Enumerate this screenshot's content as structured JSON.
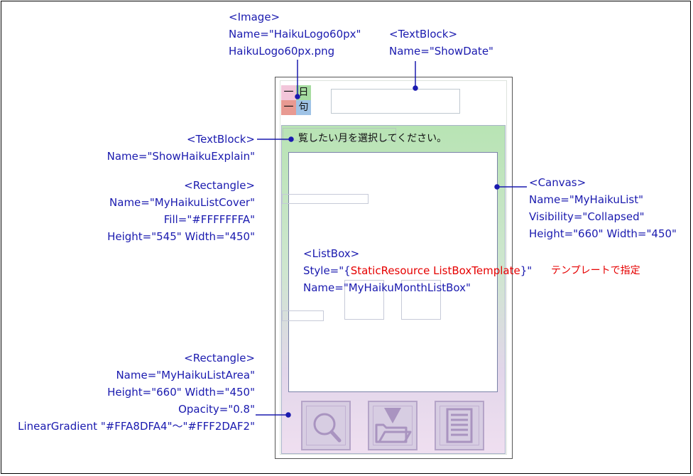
{
  "annotations": {
    "image_tag": "<Image>",
    "image_name": "Name=\"HaikuLogo60px\"",
    "image_file": "HaikuLogo60px.png",
    "showdate_tag": "<TextBlock>",
    "showdate_name": "Name=\"ShowDate\"",
    "explain_tag": "<TextBlock>",
    "explain_name": "Name=\"ShowHaikuExplain\"",
    "cover_tag": "<Rectangle>",
    "cover_name": "Name=\"MyHaikuListCover\"",
    "cover_fill": "Fill=\"#FFFFFFFA\"",
    "cover_size": "Height=\"545\" Width=\"450\"",
    "canvas_tag": "<Canvas>",
    "canvas_name": "Name=\"MyHaikuList\"",
    "canvas_visibility": "Visibility=\"Collapsed\"",
    "canvas_size": "Height=\"660\" Width=\"450\"",
    "listbox_tag": "<ListBox>",
    "listbox_style_prefix": "Style=\"{",
    "listbox_style_resource": "StaticResource ListBoxTemplate",
    "listbox_style_suffix": "}\"",
    "listbox_name": "Name=\"MyHaikuMonthListBox\"",
    "template_note": "テンプレートで指定",
    "area_tag": "<Rectangle>",
    "area_name": "Name=\"MyHaikuListArea\"",
    "area_size": "Height=\"660\" Width=\"450\"",
    "area_opacity": "Opacity=\"0.8\"",
    "area_gradient": "LinearGradient \"#FFA8DFA4\"～\"#FFF2DAF2\""
  },
  "phone": {
    "logo_chars": [
      "一",
      "日",
      "一",
      "句"
    ],
    "explain_text": "覧したい月を選択してください。"
  },
  "toolbar": {
    "icons": [
      "search-icon",
      "folder-download-icon",
      "list-icon"
    ]
  },
  "colors": {
    "annotation": "#1a1aaf",
    "note": "#e60000",
    "gradient_start": "#A8DFA4",
    "gradient_end": "#F2DAF2"
  }
}
